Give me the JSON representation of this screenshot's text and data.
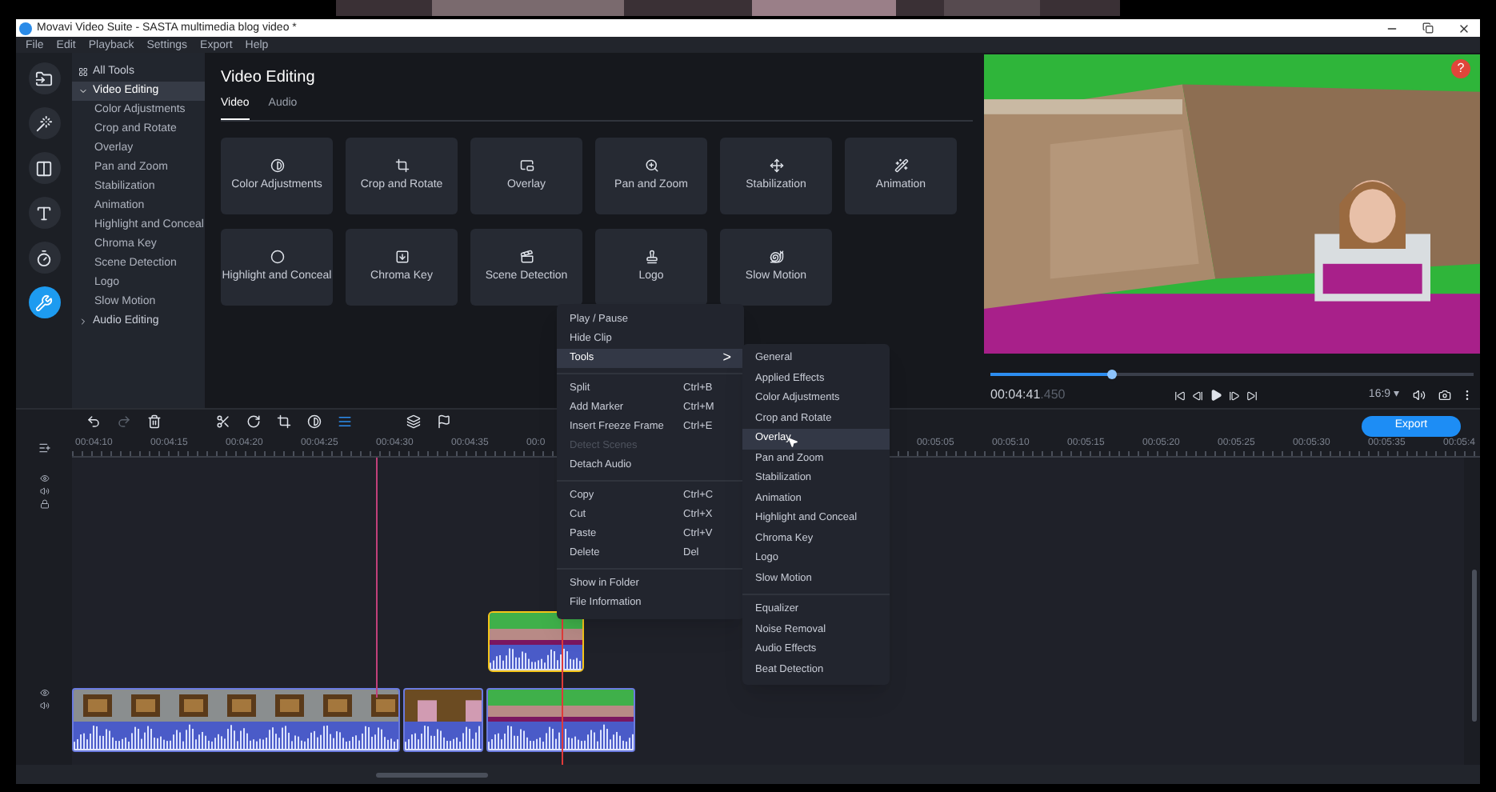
{
  "window": {
    "title": "Movavi Video Suite - SASTA multimedia blog video *"
  },
  "menu_bar": [
    "File",
    "Edit",
    "Playback",
    "Settings",
    "Export",
    "Help"
  ],
  "tools_sidebar": [
    {
      "label": "All Tools",
      "selected": false
    },
    {
      "label": "Video Editing",
      "expanded": true,
      "selected": true,
      "children": [
        {
          "label": "Color Adjustments"
        },
        {
          "label": "Crop and Rotate"
        },
        {
          "label": "Overlay"
        },
        {
          "label": "Pan and Zoom"
        },
        {
          "label": "Stabilization"
        },
        {
          "label": "Animation"
        },
        {
          "label": "Highlight and Conceal"
        },
        {
          "label": "Chroma Key"
        },
        {
          "label": "Scene Detection"
        },
        {
          "label": "Logo"
        },
        {
          "label": "Slow Motion"
        }
      ]
    },
    {
      "label": "Audio Editing",
      "expanded": false,
      "selected": false
    }
  ],
  "panel": {
    "title": "Video Editing",
    "tabs": [
      {
        "label": "Video",
        "selected": true
      },
      {
        "label": "Audio",
        "selected": false
      }
    ],
    "tiles": [
      "Color Adjustments",
      "Crop and Rotate",
      "Overlay",
      "Pan and Zoom",
      "Stabilization",
      "Animation",
      "Highlight and Conceal",
      "Chroma Key",
      "Scene Detection",
      "Logo",
      "Slow Motion"
    ]
  },
  "preview": {
    "help": "?",
    "time": "00:04:41",
    "time_fraction": ".450",
    "level": 0.25,
    "aspect": "16:9 ▾"
  },
  "context_menu": [
    {
      "kind": "item",
      "label": "Play / Pause",
      "disabled": false,
      "selected": false
    },
    {
      "kind": "item",
      "label": "Hide Clip",
      "disabled": false,
      "selected": false
    },
    {
      "kind": "submenu",
      "label": "Tools",
      "shortcut": ">",
      "disabled": false,
      "selected": true
    },
    {
      "kind": "separator"
    },
    {
      "kind": "item",
      "label": "Split",
      "shortcut": "Ctrl+B",
      "disabled": false,
      "selected": false
    },
    {
      "kind": "item",
      "label": "Add Marker",
      "shortcut": "Ctrl+M",
      "disabled": false,
      "selected": false
    },
    {
      "kind": "item",
      "label": "Insert Freeze Frame",
      "shortcut": "Ctrl+E",
      "disabled": false,
      "selected": false
    },
    {
      "kind": "item",
      "label": "Detect Scenes",
      "disabled": true,
      "selected": false
    },
    {
      "kind": "item",
      "label": "Detach Audio",
      "disabled": false,
      "selected": false
    },
    {
      "kind": "separator"
    },
    {
      "kind": "item",
      "label": "Copy",
      "shortcut": "Ctrl+C",
      "disabled": false,
      "selected": false
    },
    {
      "kind": "item",
      "label": "Cut",
      "shortcut": "Ctrl+X",
      "disabled": false,
      "selected": false
    },
    {
      "kind": "item",
      "label": "Paste",
      "shortcut": "Ctrl+V",
      "disabled": false,
      "selected": false
    },
    {
      "kind": "item",
      "label": "Delete",
      "shortcut": "Del",
      "disabled": false,
      "selected": false
    },
    {
      "kind": "separator"
    },
    {
      "kind": "item",
      "label": "Show in Folder",
      "disabled": false,
      "selected": false
    },
    {
      "kind": "item",
      "label": "File Information",
      "disabled": false,
      "selected": false
    }
  ],
  "submenu": [
    {
      "kind": "item",
      "label": "General",
      "selected": false
    },
    {
      "kind": "item",
      "label": "Applied Effects",
      "selected": false
    },
    {
      "kind": "item",
      "label": "Color Adjustments",
      "selected": false
    },
    {
      "kind": "item",
      "label": "Crop and Rotate",
      "selected": false
    },
    {
      "kind": "item",
      "label": "Overlay",
      "selected": true
    },
    {
      "kind": "item",
      "label": "Pan and Zoom",
      "selected": false
    },
    {
      "kind": "item",
      "label": "Stabilization",
      "selected": false
    },
    {
      "kind": "item",
      "label": "Animation",
      "selected": false
    },
    {
      "kind": "item",
      "label": "Highlight and Conceal",
      "selected": false
    },
    {
      "kind": "item",
      "label": "Chroma Key",
      "selected": false
    },
    {
      "kind": "item",
      "label": "Logo",
      "selected": false
    },
    {
      "kind": "item",
      "label": "Slow Motion",
      "selected": false
    },
    {
      "kind": "separator"
    },
    {
      "kind": "item",
      "label": "Equalizer",
      "selected": false
    },
    {
      "kind": "item",
      "label": "Noise Removal",
      "selected": false
    },
    {
      "kind": "item",
      "label": "Audio Effects",
      "selected": false
    },
    {
      "kind": "item",
      "label": "Beat Detection",
      "selected": false
    }
  ],
  "timeline": {
    "export": "Export",
    "ruler_left": [
      "00:04:10",
      "00:04:15",
      "00:04:20",
      "00:04:25",
      "00:04:30",
      "00:04:35",
      "00:0"
    ],
    "ruler_right": [
      "00:05:05",
      "00:05:10",
      "00:05:15",
      "00:05:20",
      "00:05:25",
      "00:05:30",
      "00:05:35",
      "00:05:4"
    ]
  }
}
